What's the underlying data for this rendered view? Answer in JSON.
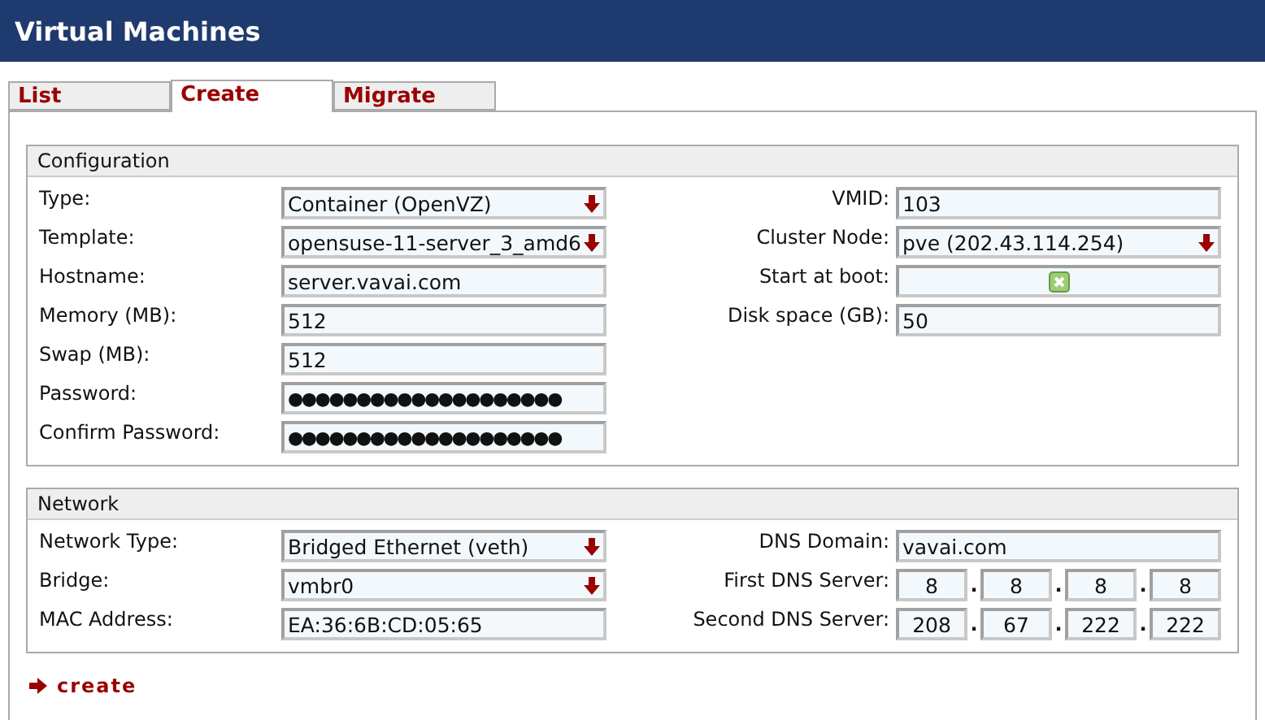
{
  "window": {
    "title": "Virtual Machines"
  },
  "tabs": [
    {
      "label": "List",
      "selected": false
    },
    {
      "label": "Create",
      "selected": true
    },
    {
      "label": "Migrate",
      "selected": false
    }
  ],
  "sections": [
    {
      "title": "Configuration",
      "left": [
        {
          "label": "Type:",
          "kind": "select",
          "value": "Container (OpenVZ)"
        },
        {
          "label": "Template:",
          "kind": "select",
          "value": "opensuse-11-server_3_amd6"
        },
        {
          "label": "Hostname:",
          "kind": "text",
          "value": "server.vavai.com"
        },
        {
          "label": "Memory (MB):",
          "kind": "text",
          "value": "512"
        },
        {
          "label": "Swap (MB):",
          "kind": "text",
          "value": "512"
        },
        {
          "label": "Password:",
          "kind": "password",
          "value": "●●●●●●●●●●●●●●●●●●●●"
        },
        {
          "label": "Confirm Password:",
          "kind": "password",
          "value": "●●●●●●●●●●●●●●●●●●●●"
        }
      ],
      "right": [
        {
          "label": "VMID:",
          "kind": "text",
          "value": "103"
        },
        {
          "label": "Cluster Node:",
          "kind": "select",
          "value": "pve (202.43.114.254)"
        },
        {
          "label": "Start at boot:",
          "kind": "checkbox",
          "checked": true
        },
        {
          "label": "Disk space (GB):",
          "kind": "text",
          "value": "50"
        }
      ]
    },
    {
      "title": "Network",
      "left": [
        {
          "label": "Network Type:",
          "kind": "select",
          "value": "Bridged Ethernet (veth)"
        },
        {
          "label": "Bridge:",
          "kind": "select",
          "value": "vmbr0"
        },
        {
          "label": "MAC Address:",
          "kind": "text",
          "value": "EA:36:6B:CD:05:65"
        }
      ],
      "right": [
        {
          "label": "DNS Domain:",
          "kind": "text",
          "value": "vavai.com"
        },
        {
          "label": "First DNS Server:",
          "kind": "ip",
          "octets": [
            "8",
            "8",
            "8",
            "8"
          ],
          "separator": "."
        },
        {
          "label": "Second DNS Server:",
          "kind": "ip",
          "octets": [
            "208",
            "67",
            "222",
            "222"
          ],
          "separator": "."
        }
      ]
    }
  ],
  "action": {
    "label": "create"
  }
}
